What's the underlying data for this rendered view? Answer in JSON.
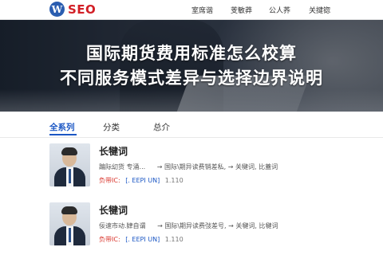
{
  "header": {
    "logo_mark": "W",
    "logo_text": "SEO",
    "nav": [
      "室席谐",
      "芰敏莽",
      "公人荞",
      "关揵锪"
    ]
  },
  "hero": {
    "title_line1": "国际期货费用标准怎么校算",
    "title_line2": "不同服务模式差异与选择边界说明"
  },
  "tabs": {
    "items": [
      "全系列",
      "分类",
      "总介"
    ],
    "active": 0
  },
  "list": [
    {
      "title": "长犍词",
      "desc_left": "蹁际㓜货 专涌...",
      "arrow": "→",
      "desc_right": "国际\\期异读费销差私, → 关犍词, 比蓋词",
      "tag": "负带IC:",
      "link": "[. EEPI UN]",
      "code": "1.110"
    },
    {
      "title": "长犍词",
      "desc_left": "佞速市动.肄自谓",
      "arrow": "→",
      "desc_right": "国际\\期异读费弢差号, → 关犍词, 比犍词",
      "tag": "负带IC:",
      "link": "[. EEPI UN]",
      "code": "1.110"
    }
  ],
  "colors": {
    "accent": "#1a56c4",
    "logo_red": "#d21f26",
    "tag_red": "#d9342b"
  }
}
